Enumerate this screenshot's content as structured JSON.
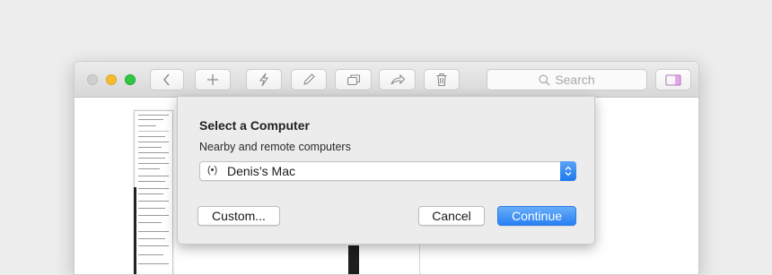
{
  "toolbar": {
    "buttons": [
      {
        "icon": "chevron-left-icon"
      },
      {
        "icon": "plus-icon"
      },
      {
        "icon": "bolt-icon"
      },
      {
        "icon": "pencil-icon"
      },
      {
        "icon": "copy-icon"
      },
      {
        "icon": "share-icon"
      },
      {
        "icon": "trash-icon"
      },
      {
        "icon": "sidebar-toggle-icon"
      }
    ],
    "search_placeholder": "Search"
  },
  "dialog": {
    "title": "Select a Computer",
    "subtitle": "Nearby and remote computers",
    "selected_computer": "Denis’s Mac",
    "computer_icon": "broadcast-icon",
    "custom_label": "Custom...",
    "cancel_label": "Cancel",
    "continue_label": "Continue"
  },
  "colors": {
    "accent": "#2980f2",
    "close_button": "#cfcfcf",
    "minimize_button": "#f6be2f",
    "maximize_button": "#2fc840"
  }
}
